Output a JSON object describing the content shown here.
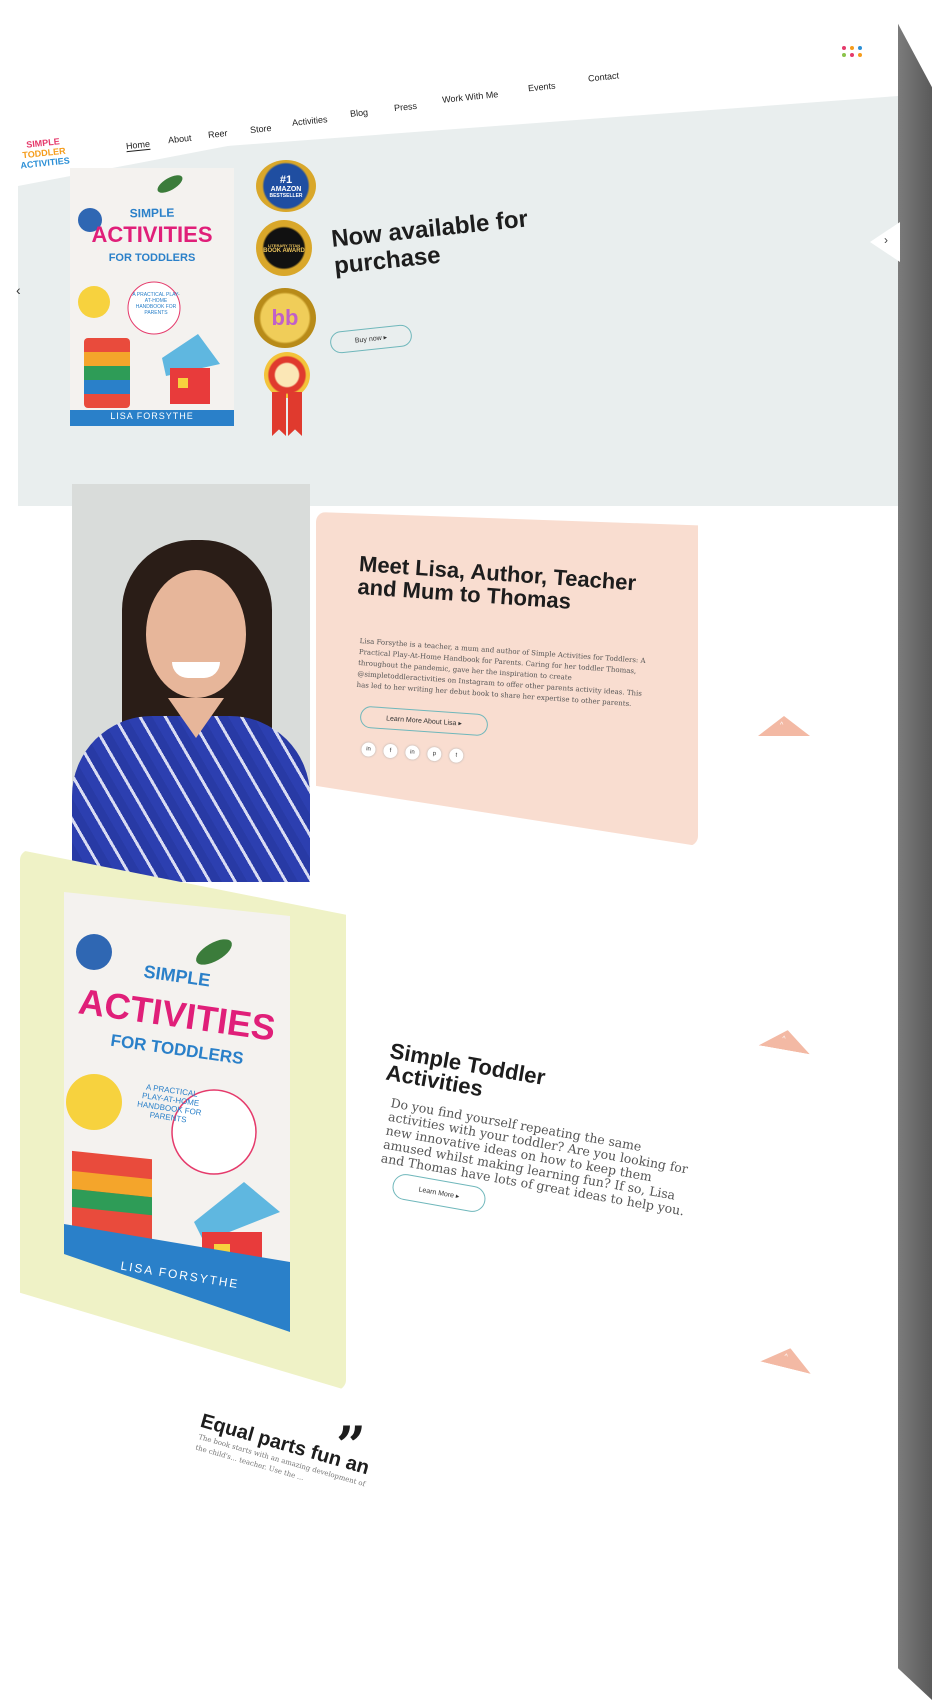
{
  "logo": {
    "line1": "SIMPLE",
    "line2": "TODDLER",
    "line3": "ACTIVITIES"
  },
  "nav": {
    "items": [
      {
        "label": "Home"
      },
      {
        "label": "About"
      },
      {
        "label": "Reer"
      },
      {
        "label": "Store"
      },
      {
        "label": "Activities"
      },
      {
        "label": "Blog"
      },
      {
        "label": "Press"
      },
      {
        "label": "Work With Me"
      },
      {
        "label": "Events"
      },
      {
        "label": "Contact"
      }
    ]
  },
  "hero": {
    "title": "Now available for purchase",
    "buy_button": "Buy now ▸",
    "badges": [
      {
        "top": "#1",
        "main": "AMAZON",
        "bottom": "BESTSELLER"
      },
      {
        "top": "LITERARY TITAN",
        "main": "BOOK AWARD",
        "bottom": ""
      },
      {
        "top": "",
        "main": "bb",
        "bottom": ""
      },
      {
        "top": "",
        "main": "",
        "bottom": ""
      }
    ]
  },
  "book": {
    "title_simple": "SIMPLE",
    "title_activities": "ACTIVITIES",
    "title_for": "FOR TODDLERS",
    "subtitle": "A PRACTICAL PLAY-AT-HOME HANDBOOK FOR PARENTS",
    "author": "LISA FORSYTHE"
  },
  "about": {
    "title": "Meet Lisa, Author, Teacher and Mum to Thomas",
    "text": "Lisa Forsythe is a teacher, a mum and author of Simple Activities for Toddlers: A Practical Play-At-Home Handbook for Parents. Caring for her toddler Thomas, throughout the pandemic, gave her the inspiration to create @simpletoddleractivities on Instagram to offer other parents activity ideas. This has led to her writing her debut book to share her expertise to other parents.",
    "button": "Learn More About Lisa ▸",
    "socials": [
      "in",
      "f",
      "in",
      "p",
      "t"
    ]
  },
  "activities": {
    "title": "Simple Toddler Activities",
    "text": "Do you find yourself repeating the same activities with your toddler? Are you looking for new innovative ideas on how to keep them amused whilst making learning fun? If so, Lisa and Thomas have lots of great ideas to help you.",
    "button": "Learn More ▸"
  },
  "quote": {
    "title": "Equal parts fun an",
    "mark": "”",
    "text": "The book starts with an amazing development of the child's... teacher. Use the ... "
  },
  "colors": {
    "accent": "#6fb7bb",
    "peach": "#f9ddd0",
    "lime": "#eff2c6",
    "hero_bg": "#e9eeee",
    "triangle": "#f3b9a4"
  }
}
